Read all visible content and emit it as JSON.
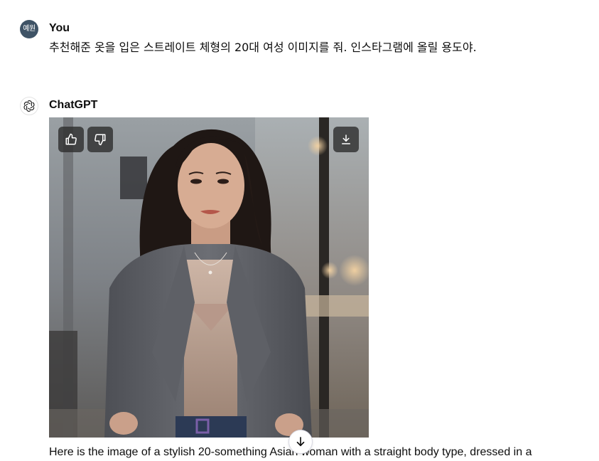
{
  "conversation": {
    "user": {
      "avatar_initials": "예원",
      "name": "You",
      "message": "추천해준 옷을 입은 스트레이트 체형의 20대 여성 이미지를 줘. 인스타그램에 올릴 용도야."
    },
    "assistant": {
      "name": "ChatGPT",
      "image": {
        "icons": {
          "like": "thumbs-up-icon",
          "dislike": "thumbs-down-icon",
          "download": "download-icon"
        }
      },
      "reply": "Here is the image of a stylish 20-something Asian woman with a straight body type, dressed in a"
    }
  },
  "scroll_button": {
    "icon": "arrow-down-icon"
  },
  "colors": {
    "user_avatar_bg": "#3f5366",
    "text": "#0d0d0d",
    "image_button_bg": "#303030"
  }
}
